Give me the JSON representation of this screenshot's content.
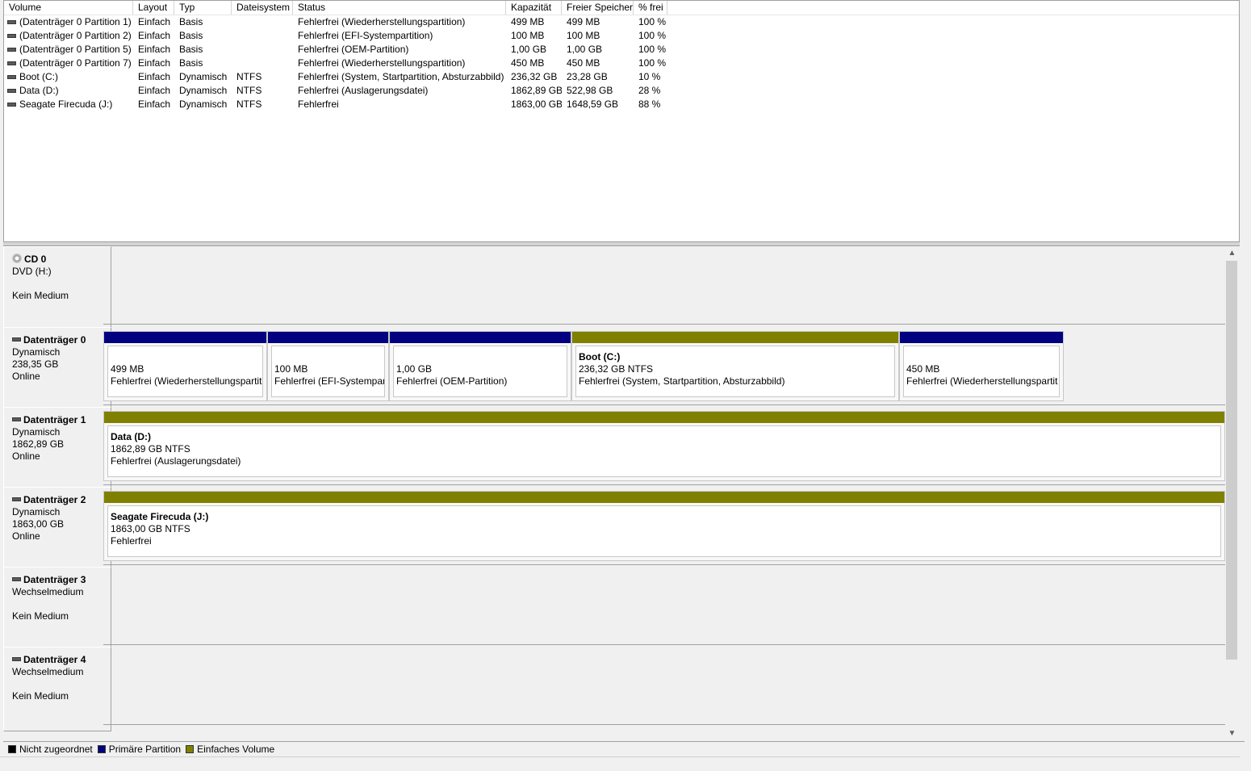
{
  "volume_list": {
    "columns": [
      "Volume",
      "Layout",
      "Typ",
      "Dateisystem",
      "Status",
      "Kapazität",
      "Freier Speicher",
      "% frei"
    ],
    "rows": [
      [
        "(Datenträger 0 Partition 1)",
        "Einfach",
        "Basis",
        "",
        "Fehlerfrei (Wiederherstellungspartition)",
        "499 MB",
        "499 MB",
        "100 %"
      ],
      [
        "(Datenträger 0 Partition 2)",
        "Einfach",
        "Basis",
        "",
        "Fehlerfrei (EFI-Systempartition)",
        "100 MB",
        "100 MB",
        "100 %"
      ],
      [
        "(Datenträger 0 Partition 5)",
        "Einfach",
        "Basis",
        "",
        "Fehlerfrei (OEM-Partition)",
        "1,00 GB",
        "1,00 GB",
        "100 %"
      ],
      [
        "(Datenträger 0 Partition 7)",
        "Einfach",
        "Basis",
        "",
        "Fehlerfrei (Wiederherstellungspartition)",
        "450 MB",
        "450 MB",
        "100 %"
      ],
      [
        "Boot (C:)",
        "Einfach",
        "Dynamisch",
        "NTFS",
        "Fehlerfrei (System, Startpartition, Absturzabbild)",
        "236,32 GB",
        "23,28 GB",
        "10 %"
      ],
      [
        "Data (D:)",
        "Einfach",
        "Dynamisch",
        "NTFS",
        "Fehlerfrei (Auslagerungsdatei)",
        "1862,89 GB",
        "522,98 GB",
        "28 %"
      ],
      [
        "Seagate Firecuda (J:)",
        "Einfach",
        "Dynamisch",
        "NTFS",
        "Fehlerfrei",
        "1863,00 GB",
        "1648,59 GB",
        "88 %"
      ]
    ]
  },
  "disks": [
    {
      "title": "CD 0",
      "line1": "DVD (H:)",
      "line2": "",
      "line3": "Kein Medium",
      "icon": "cd-icon"
    },
    {
      "title": "Datenträger 0",
      "line1": "Dynamisch",
      "line2": "238,35 GB",
      "line3": "Online",
      "icon": "disk-icon",
      "partitions": [
        {
          "name": "",
          "size": "499 MB",
          "status": "Fehlerfrei (Wiederherstellungspartiti",
          "kind": "primary"
        },
        {
          "name": "",
          "size": "100 MB",
          "status": "Fehlerfrei (EFI-Systempart",
          "kind": "primary"
        },
        {
          "name": "",
          "size": "1,00 GB",
          "status": "Fehlerfrei (OEM-Partition)",
          "kind": "primary"
        },
        {
          "name": "Boot  (C:)",
          "size": "236,32 GB NTFS",
          "status": "Fehlerfrei (System, Startpartition, Absturzabbild)",
          "kind": "simple"
        },
        {
          "name": "",
          "size": "450 MB",
          "status": "Fehlerfrei (Wiederherstellungspartit",
          "kind": "primary"
        }
      ]
    },
    {
      "title": "Datenträger 1",
      "line1": "Dynamisch",
      "line2": "1862,89 GB",
      "line3": "Online",
      "icon": "disk-icon",
      "partitions": [
        {
          "name": "Data  (D:)",
          "size": "1862,89 GB NTFS",
          "status": "Fehlerfrei (Auslagerungsdatei)",
          "kind": "simple"
        }
      ]
    },
    {
      "title": "Datenträger 2",
      "line1": "Dynamisch",
      "line2": "1863,00 GB",
      "line3": "Online",
      "icon": "disk-icon",
      "partitions": [
        {
          "name": "Seagate Firecuda  (J:)",
          "size": "1863,00 GB NTFS",
          "status": "Fehlerfrei",
          "kind": "simple"
        }
      ]
    },
    {
      "title": "Datenträger 3",
      "line1": "Wechselmedium",
      "line2": "",
      "line3": "Kein Medium",
      "icon": "disk-icon"
    },
    {
      "title": "Datenträger 4",
      "line1": "Wechselmedium",
      "line2": "",
      "line3": "Kein Medium",
      "icon": "disk-icon"
    }
  ],
  "legend": [
    {
      "label": "Nicht zugeordnet",
      "color": "#000000"
    },
    {
      "label": "Primäre Partition",
      "color": "#000080"
    },
    {
      "label": "Einfaches Volume",
      "color": "#808000"
    }
  ],
  "colors": {
    "primary": "#000080",
    "simple": "#808000",
    "unallocated": "#000000"
  },
  "scrollbar": {
    "up_icon": "chevron-up-icon",
    "down_icon": "chevron-down-icon"
  }
}
